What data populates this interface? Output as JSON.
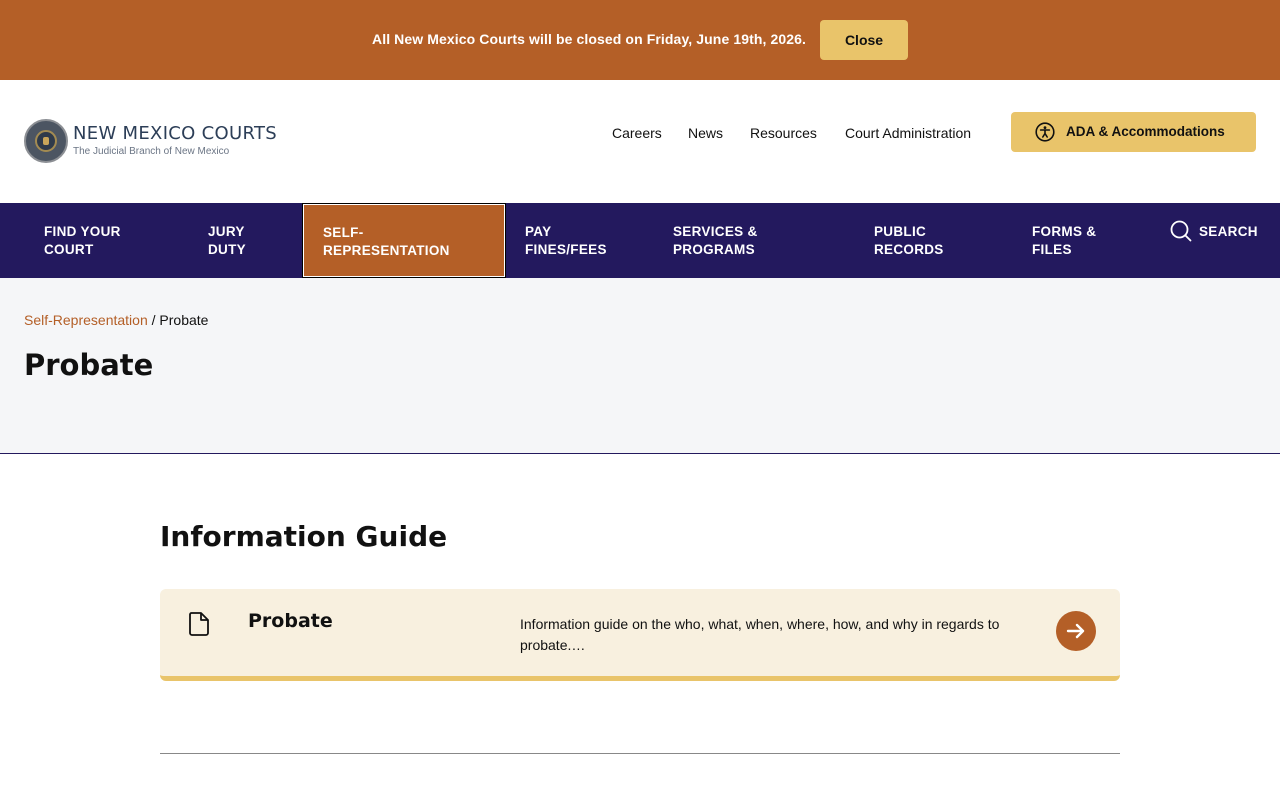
{
  "alert": {
    "message": "All New Mexico Courts will be closed on Friday, June 19th, 2026.",
    "close_label": "Close"
  },
  "header": {
    "logo_title": "NEW MEXICO COURTS",
    "logo_subtitle": "The Judicial Branch of New Mexico",
    "links": [
      "Careers",
      "News",
      "Resources",
      "Court Administration"
    ],
    "ada_label": "ADA & Accommodations"
  },
  "nav": {
    "items": [
      {
        "line1": "Find your",
        "line2": "court"
      },
      {
        "line1": "Jury",
        "line2": "duty"
      },
      {
        "line1": "Self-",
        "line2": "Representation"
      },
      {
        "line1": "Pay",
        "line2": "fines/fees"
      },
      {
        "line1": "Services &",
        "line2": "Programs"
      },
      {
        "line1": "Public",
        "line2": "Records"
      },
      {
        "line1": "Forms &",
        "line2": "Files"
      }
    ],
    "active_index": 2,
    "search_label": "SEARCH"
  },
  "hero": {
    "breadcrumb_parent": "Self-Representation",
    "breadcrumb_separator": " / ",
    "breadcrumb_current": "Probate",
    "title": "Probate"
  },
  "section": {
    "title": "Information Guide",
    "card": {
      "icon": "document-icon",
      "title": "Probate",
      "description": "Information guide on the who, what, when, where, how, and why in regards to probate.…",
      "arrow_icon": "arrow-right-icon"
    }
  },
  "colors": {
    "brand_orange": "#b45f27",
    "accent_gold": "#e9c46a",
    "nav_navy": "#23195e",
    "card_bg": "#f8f0df",
    "hero_bg": "#f5f6f8"
  }
}
